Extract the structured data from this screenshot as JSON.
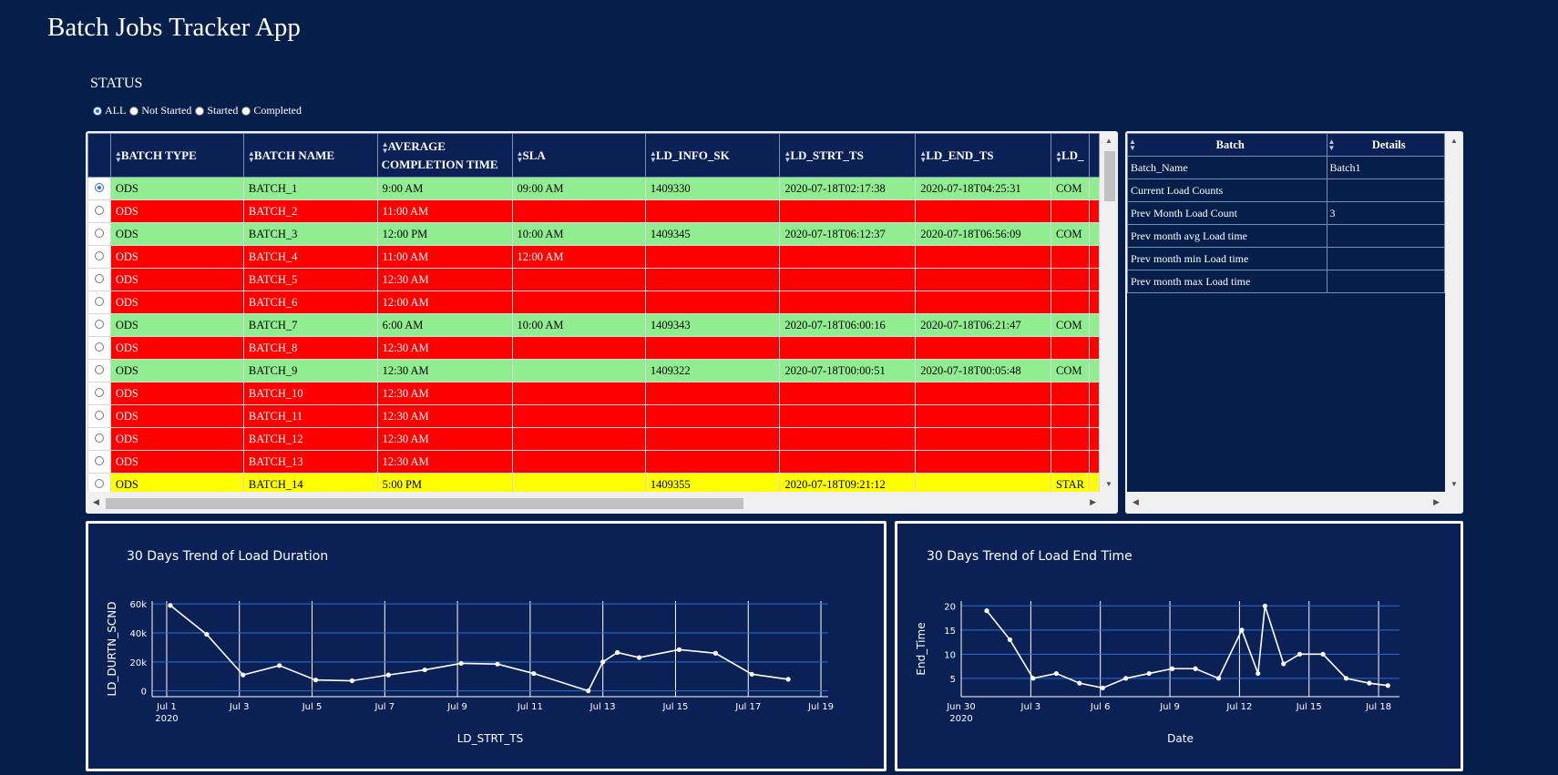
{
  "app_title": "Batch Jobs Tracker App",
  "status": {
    "label": "STATUS",
    "options": [
      "ALL",
      "Not Started",
      "Started",
      "Completed"
    ],
    "selected": "ALL"
  },
  "main_table": {
    "columns": [
      "BATCH TYPE",
      "BATCH NAME",
      "AVERAGE COMPLETION TIME",
      "SLA",
      "LD_INFO_SK",
      "LD_STRT_TS",
      "LD_END_TS",
      "LD_"
    ],
    "rows": [
      {
        "status": "green",
        "selected": true,
        "cells": [
          "ODS",
          "BATCH_1",
          "9:00 AM",
          "09:00 AM",
          "1409330",
          "2020-07-18T02:17:38",
          "2020-07-18T04:25:31",
          "COM"
        ]
      },
      {
        "status": "red",
        "selected": false,
        "cells": [
          "ODS",
          "BATCH_2",
          "11:00 AM",
          "",
          "",
          "",
          "",
          ""
        ]
      },
      {
        "status": "green",
        "selected": false,
        "cells": [
          "ODS",
          "BATCH_3",
          "12:00 PM",
          "10:00 AM",
          "1409345",
          "2020-07-18T06:12:37",
          "2020-07-18T06:56:09",
          "COM"
        ]
      },
      {
        "status": "red",
        "selected": false,
        "cells": [
          "ODS",
          "BATCH_4",
          "11:00 AM",
          "12:00 AM",
          "",
          "",
          "",
          ""
        ]
      },
      {
        "status": "red",
        "selected": false,
        "cells": [
          "ODS",
          "BATCH_5",
          "12:30 AM",
          "",
          "",
          "",
          "",
          ""
        ]
      },
      {
        "status": "red",
        "selected": false,
        "cells": [
          "ODS",
          "BATCH_6",
          "12:00 AM",
          "",
          "",
          "",
          "",
          ""
        ]
      },
      {
        "status": "green",
        "selected": false,
        "cells": [
          "ODS",
          "BATCH_7",
          "6:00 AM",
          "10:00 AM",
          "1409343",
          "2020-07-18T06:00:16",
          "2020-07-18T06:21:47",
          "COM"
        ]
      },
      {
        "status": "red",
        "selected": false,
        "cells": [
          "ODS",
          "BATCH_8",
          "12:30 AM",
          "",
          "",
          "",
          "",
          ""
        ]
      },
      {
        "status": "green",
        "selected": false,
        "cells": [
          "ODS",
          "BATCH_9",
          "12:30 AM",
          "",
          "1409322",
          "2020-07-18T00:00:51",
          "2020-07-18T00:05:48",
          "COM"
        ]
      },
      {
        "status": "red",
        "selected": false,
        "cells": [
          "ODS",
          "BATCH_10",
          "12:30 AM",
          "",
          "",
          "",
          "",
          ""
        ]
      },
      {
        "status": "red",
        "selected": false,
        "cells": [
          "ODS",
          "BATCH_11",
          "12:30 AM",
          "",
          "",
          "",
          "",
          ""
        ]
      },
      {
        "status": "red",
        "selected": false,
        "cells": [
          "ODS",
          "BATCH_12",
          "12:30 AM",
          "",
          "",
          "",
          "",
          ""
        ]
      },
      {
        "status": "red",
        "selected": false,
        "cells": [
          "ODS",
          "BATCH_13",
          "12:30 AM",
          "",
          "",
          "",
          "",
          ""
        ]
      },
      {
        "status": "yellow",
        "selected": false,
        "cells": [
          "ODS",
          "BATCH_14",
          "5:00 PM",
          "",
          "1409355",
          "2020-07-18T09:21:12",
          "",
          "STAR"
        ]
      }
    ]
  },
  "detail_table": {
    "columns": [
      "Batch",
      "Details"
    ],
    "rows": [
      [
        "Batch_Name",
        "Batch1"
      ],
      [
        "Current Load Counts",
        ""
      ],
      [
        "Prev Month Load Count",
        "3"
      ],
      [
        "Prev month avg Load time",
        ""
      ],
      [
        "Prev month min Load time",
        ""
      ],
      [
        "Prev month max Load time",
        ""
      ]
    ]
  },
  "colors": {
    "background": "#061e4a",
    "panel": "#0b2155",
    "completed": "#90ee90",
    "not_started": "#ff0000",
    "started": "#ffff00"
  },
  "chart_data": [
    {
      "type": "line",
      "title": "30 Days Trend of Load Duration",
      "xlabel": "LD_STRT_TS",
      "ylabel": "LD_DURTN_SCND",
      "x_ticks": [
        "Jul 1",
        "Jul 3",
        "Jul 5",
        "Jul 7",
        "Jul 9",
        "Jul 11",
        "Jul 13",
        "Jul 15",
        "Jul 17",
        "Jul 19"
      ],
      "x_year_label": "2020",
      "y_ticks": [
        "0",
        "20k",
        "40k",
        "60k"
      ],
      "xlim": [
        0.6,
        19.2
      ],
      "ylim": [
        -4000,
        62000
      ],
      "x": [
        1.1,
        2.1,
        3.1,
        4.1,
        5.1,
        6.1,
        7.1,
        8.1,
        9.1,
        10.1,
        11.1,
        12.6,
        13.0,
        13.4,
        14.0,
        15.1,
        16.1,
        17.1,
        18.1
      ],
      "y": [
        59000,
        39000,
        11000,
        17500,
        7500,
        7000,
        11000,
        14500,
        19000,
        18500,
        12000,
        0,
        20000,
        26500,
        23000,
        28500,
        26000,
        11500,
        8000
      ],
      "grid": true
    },
    {
      "type": "line",
      "title": "30 Days Trend of Load End Time",
      "xlabel": "Date",
      "ylabel": "End_Time",
      "x_ticks": [
        "Jun 30",
        "Jul 3",
        "Jul 6",
        "Jul 9",
        "Jul 12",
        "Jul 15",
        "Jul 18"
      ],
      "x_year_label": "2020",
      "y_ticks": [
        "5",
        "10",
        "15",
        "20"
      ],
      "xlim": [
        0,
        18.9
      ],
      "ylim": [
        1.2,
        21
      ],
      "x": [
        1.1,
        2.1,
        3.1,
        4.1,
        5.1,
        6.1,
        7.1,
        8.1,
        9.1,
        10.1,
        11.1,
        12.1,
        12.8,
        13.1,
        13.9,
        14.6,
        15.6,
        16.6,
        17.6,
        18.4
      ],
      "y": [
        19,
        13,
        5,
        6,
        4,
        3,
        5,
        6,
        7,
        7,
        5,
        15,
        6,
        20,
        8,
        10,
        10,
        5,
        4,
        3.5
      ],
      "grid": true
    }
  ]
}
